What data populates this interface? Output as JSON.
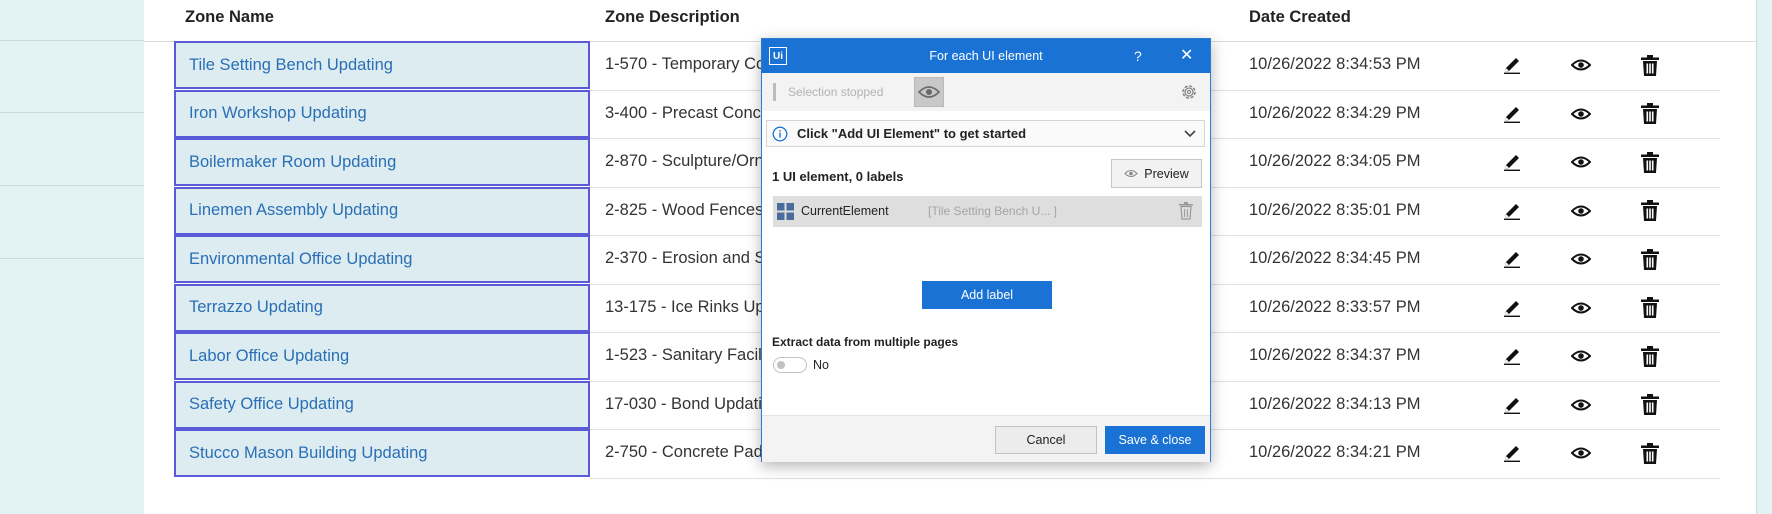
{
  "table": {
    "headers": {
      "zone_name": "Zone Name",
      "zone_description": "Zone Description",
      "date_created": "Date Created"
    },
    "rows": [
      {
        "name": "Tile Setting Bench Updating",
        "description": "1-570 - Temporary Co",
        "date": "10/26/2022 8:34:53 PM"
      },
      {
        "name": "Iron Workshop Updating",
        "description": "3-400 - Precast Concre",
        "date": "10/26/2022 8:34:29 PM"
      },
      {
        "name": "Boilermaker Room Updating",
        "description": "2-870 - Sculpture/Orn",
        "date": "10/26/2022 8:34:05 PM"
      },
      {
        "name": "Linemen Assembly Updating",
        "description": "2-825 - Wood Fences",
        "date": "10/26/2022 8:35:01 PM"
      },
      {
        "name": "Environmental Office Updating",
        "description": "2-370 - Erosion and Se",
        "date": "10/26/2022 8:34:45 PM"
      },
      {
        "name": "Terrazzo Updating",
        "description": "13-175 - Ice Rinks Upd",
        "date": "10/26/2022 8:33:57 PM"
      },
      {
        "name": "Labor Office Updating",
        "description": "1-523 - Sanitary Facilit",
        "date": "10/26/2022 8:34:37 PM"
      },
      {
        "name": "Safety Office Updating",
        "description": "17-030 - Bond Updatin",
        "date": "10/26/2022 8:34:13 PM"
      },
      {
        "name": "Stucco Mason Building Updating",
        "description": "2-750 - Concrete Pads and Walks Updating",
        "date": "10/26/2022 8:34:21 PM"
      }
    ],
    "row_actions": [
      "pencil-icon",
      "eye-icon",
      "trash-icon"
    ]
  },
  "dialog": {
    "logo": "Ui",
    "title": "For each UI element",
    "help": "?",
    "close": "✕",
    "selection_status": "Selection stopped",
    "info_text": "Click \"Add UI Element\" to get started",
    "count_text": "1 UI element, 0 labels",
    "preview_label": "Preview",
    "element": {
      "name": "CurrentElement",
      "value": "[Tile Setting Bench U... ]"
    },
    "add_label": "Add label",
    "extract_label": "Extract data from multiple pages",
    "toggle_value": "No",
    "cancel_label": "Cancel",
    "save_label": "Save & close"
  },
  "colors": {
    "accent": "#1a73d4",
    "link": "#2a6fb5",
    "selection_border": "#5a5ad6",
    "selection_fill": "#dcecf1",
    "sidebar": "#e3f2f3"
  }
}
